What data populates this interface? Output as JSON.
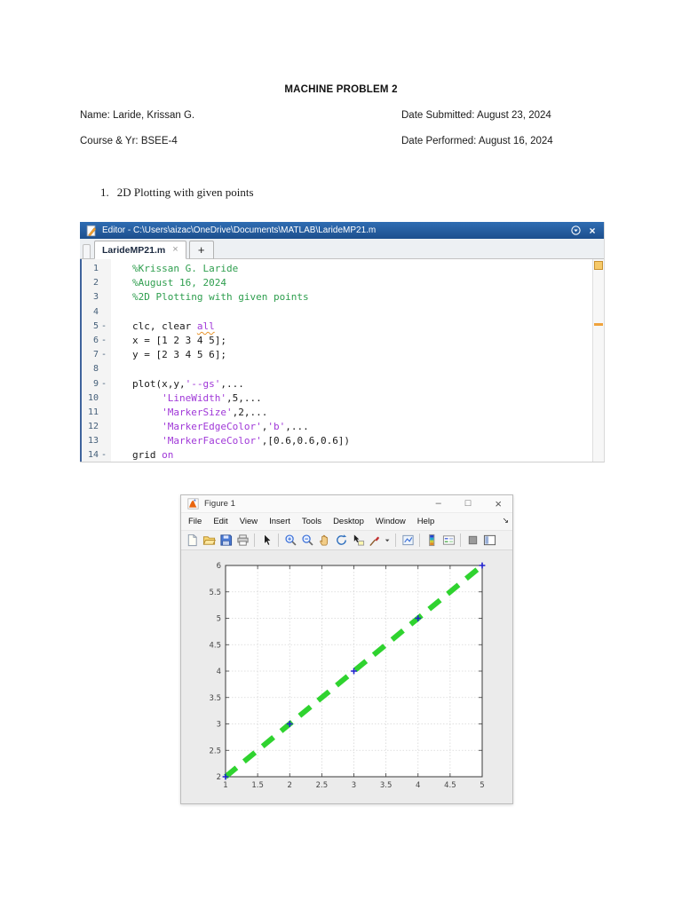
{
  "colors": {
    "comment": "#2e9e4e",
    "string": "#a038d8",
    "editor_titlebar": "#24588f",
    "warning_marker": "#efa33d",
    "line_color": "#2fd32f",
    "marker_color": "#2121cf"
  },
  "document": {
    "title": "MACHINE PROBLEM 2",
    "name": "Name: Laride, Krissan G.",
    "course": "Course & Yr: BSEE-4",
    "date_submitted": "Date Submitted: August 23, 2024",
    "date_performed": "Date Performed: August 16, 2024",
    "item_number": "1.",
    "item_text": "2D Plotting with given points"
  },
  "editor": {
    "window_title": "Editor - C:\\Users\\aizac\\OneDrive\\Documents\\MATLAB\\LarideMP21.m",
    "tab_label": "LarideMP21.m",
    "tab_close_glyph": "×",
    "new_tab_glyph": "+",
    "titlebar_close_glyph": "×",
    "lines": [
      {
        "n": "1",
        "d": "",
        "s": [
          {
            "c": "cm",
            "t": "%Krissan G. Laride"
          }
        ]
      },
      {
        "n": "2",
        "d": "",
        "s": [
          {
            "c": "cm",
            "t": "%August 16, 2024"
          }
        ]
      },
      {
        "n": "3",
        "d": "",
        "s": [
          {
            "c": "cm",
            "t": "%2D Plotting with given points"
          }
        ]
      },
      {
        "n": "4",
        "d": "",
        "s": []
      },
      {
        "n": "5",
        "d": "-",
        "s": [
          {
            "c": "tx",
            "t": "clc, clear "
          },
          {
            "c": "warn",
            "t": "all"
          }
        ]
      },
      {
        "n": "6",
        "d": "-",
        "s": [
          {
            "c": "tx",
            "t": "x = [1 2 3 4 5];"
          }
        ]
      },
      {
        "n": "7",
        "d": "-",
        "s": [
          {
            "c": "tx",
            "t": "y = [2 3 4 5 6];"
          }
        ]
      },
      {
        "n": "8",
        "d": "",
        "s": []
      },
      {
        "n": "9",
        "d": "-",
        "s": [
          {
            "c": "tx",
            "t": "plot(x,y,"
          },
          {
            "c": "str",
            "t": "'--gs'"
          },
          {
            "c": "tx",
            "t": ",..."
          }
        ]
      },
      {
        "n": "10",
        "d": "",
        "s": [
          {
            "c": "tx",
            "t": "     "
          },
          {
            "c": "str",
            "t": "'LineWidth'"
          },
          {
            "c": "tx",
            "t": ",5,..."
          }
        ]
      },
      {
        "n": "11",
        "d": "",
        "s": [
          {
            "c": "tx",
            "t": "     "
          },
          {
            "c": "str",
            "t": "'MarkerSize'"
          },
          {
            "c": "tx",
            "t": ",2,..."
          }
        ]
      },
      {
        "n": "12",
        "d": "",
        "s": [
          {
            "c": "tx",
            "t": "     "
          },
          {
            "c": "str",
            "t": "'MarkerEdgeColor'"
          },
          {
            "c": "tx",
            "t": ","
          },
          {
            "c": "str",
            "t": "'b'"
          },
          {
            "c": "tx",
            "t": ",..."
          }
        ]
      },
      {
        "n": "13",
        "d": "",
        "s": [
          {
            "c": "tx",
            "t": "     "
          },
          {
            "c": "str",
            "t": "'MarkerFaceColor'"
          },
          {
            "c": "tx",
            "t": ",[0.6,0.6,0.6])"
          }
        ]
      },
      {
        "n": "14",
        "d": "-",
        "s": [
          {
            "c": "tx",
            "t": "grid "
          },
          {
            "c": "str",
            "t": "on"
          }
        ]
      }
    ]
  },
  "figure": {
    "window_title": "Figure 1",
    "controls": {
      "minimize": "–",
      "maximize": "□",
      "close": "×"
    },
    "menus": [
      "File",
      "Edit",
      "View",
      "Insert",
      "Tools",
      "Desktop",
      "Window",
      "Help"
    ],
    "menu_corner_glyph": "↘",
    "toolbar": [
      "new-file-icon",
      "open-file-icon",
      "save-icon",
      "print-icon",
      "sep",
      "cursor-icon",
      "sep",
      "zoom-in-icon",
      "zoom-out-icon",
      "pan-icon",
      "rotate-3d-icon",
      "data-cursor-icon",
      "brush-icon",
      "caret-down-icon",
      "sep",
      "link-plot-icon",
      "sep",
      "colorbar-icon",
      "legend-icon",
      "sep",
      "dock-icon",
      "window-layout-icon"
    ]
  },
  "chart_data": {
    "type": "line",
    "title": "",
    "xlabel": "",
    "ylabel": "",
    "x": [
      1,
      2,
      3,
      4,
      5
    ],
    "y": [
      2,
      3,
      4,
      5,
      6
    ],
    "xlim": [
      1,
      5
    ],
    "ylim": [
      2,
      6
    ],
    "xticks": [
      1,
      1.5,
      2,
      2.5,
      3,
      3.5,
      4,
      4.5,
      5
    ],
    "yticks": [
      2,
      2.5,
      3,
      3.5,
      4,
      4.5,
      5,
      5.5,
      6
    ],
    "grid": true,
    "box": true,
    "line": {
      "style": "dashed",
      "color": "#2fd32f",
      "width": 6
    },
    "marker": {
      "shape": "s",
      "color": "#2121cf",
      "size": 2
    },
    "plot_background": "#ffffff",
    "figure_background": "#ebebeb"
  }
}
